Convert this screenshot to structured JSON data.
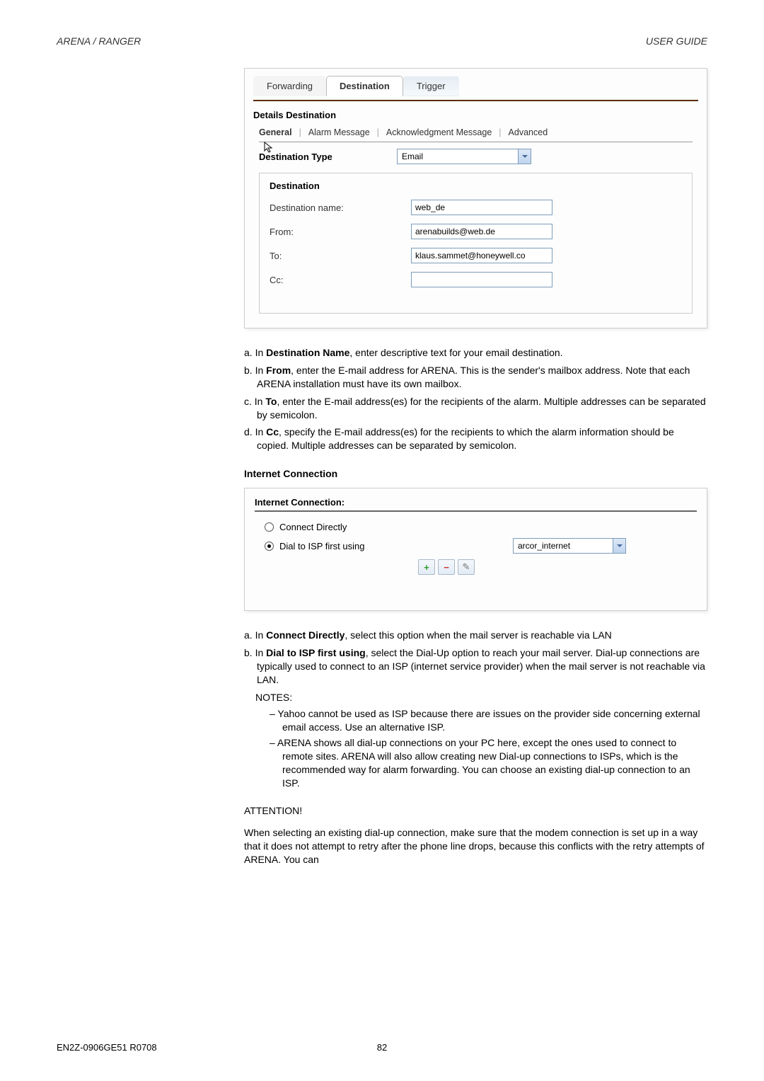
{
  "header": {
    "left": "ARENA / RANGER",
    "right": "USER GUIDE"
  },
  "panel1": {
    "tabs": {
      "forwarding": "Forwarding",
      "destination": "Destination",
      "trigger": "Trigger"
    },
    "section_title": "Details Destination",
    "subtabs": {
      "general": "General",
      "alarm": "Alarm Message",
      "ack": "Acknowledgment Message",
      "advanced": "Advanced"
    },
    "dest_type_label": "Destination Type",
    "dest_type_value": "Email",
    "dest_title": "Destination",
    "rows": {
      "name_label": "Destination name:",
      "name_value": "web_de",
      "from_label": "From:",
      "from_value": "arenabuilds@web.de",
      "to_label": "To:",
      "to_value": "klaus.sammet@honeywell.co",
      "cc_label": "Cc:",
      "cc_value": ""
    }
  },
  "instr1": {
    "a": "a. In Destination Name, enter descriptive text for your email destination.",
    "b": "b. In From, enter the E-mail address for ARENA. This is the sender's mailbox address. Note that each ARENA installation must have its own mailbox.",
    "c": "c. In To, enter the E-mail address(es) for the recipients of the alarm. Multiple addresses can be separated by semicolon.",
    "d": "d. In Cc, specify the E-mail address(es) for the recipients to which the alarm information should be copied. Multiple addresses can be separated by semicolon."
  },
  "subsection_title": "Internet Connection",
  "panel2": {
    "title": "Internet Connection:",
    "opt_direct": "Connect Directly",
    "opt_dial": "Dial to ISP first using",
    "isp_value": "arcor_internet"
  },
  "instr2": {
    "a_pre": "a. In ",
    "a_b": "Connect Directly",
    "a_post": ", select this option when the mail server is reachable via LAN",
    "b_pre": "b. In ",
    "b_b": "Dial to ISP first using",
    "b_post": ", select the Dial-Up option to reach your mail server. Dial-up connections are typically used to connect to an ISP (internet service provider) when the mail server is not reachable via LAN.",
    "notes_label": "NOTES:",
    "note1": "– Yahoo cannot be used as ISP because there are issues on the provider side concerning external email access. Use an alternative ISP.",
    "note2": "– ARENA shows all dial-up connections on your PC here, except the ones used to connect to remote sites. ARENA will also allow creating new Dial-up connections to ISPs, which is the recommended way for alarm forwarding. You can choose an existing dial-up connection to an ISP.",
    "attention_label": "ATTENTION!",
    "attention_text": "When selecting an existing dial-up connection, make sure that the modem connection is set up in a way that it does not attempt to retry after the phone line drops, because this conflicts with the retry attempts of ARENA. You can"
  },
  "footer": {
    "doc": "EN2Z-0906GE51 R0708",
    "page": "82"
  }
}
